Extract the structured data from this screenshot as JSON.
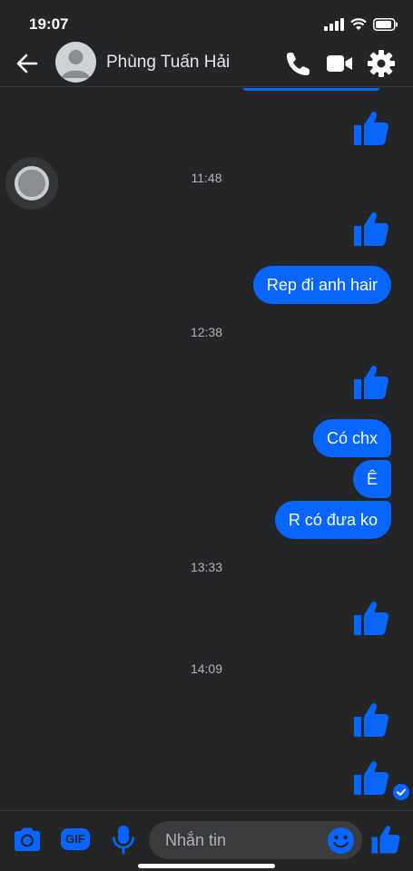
{
  "status_bar": {
    "time": "19:07"
  },
  "header": {
    "contact_name": "Phùng Tuấn Hải"
  },
  "chat": {
    "timestamps": [
      "11:48",
      "12:38",
      "13:33",
      "14:09"
    ],
    "messages": [
      "Rep đi anh hair",
      "Có chx",
      "Ê",
      "R có đưa ko"
    ]
  },
  "composer": {
    "placeholder": "Nhắn tin",
    "gif_label": "GIF"
  },
  "colors": {
    "accent": "#0866ff",
    "background": "#242526",
    "bubble_text": "#ffffff"
  },
  "icons": [
    "back-arrow-icon",
    "phone-icon",
    "video-camera-icon",
    "gear-icon",
    "like-icon",
    "camera-icon",
    "gif-icon",
    "microphone-icon",
    "emoji-icon",
    "seen-check-icon"
  ]
}
